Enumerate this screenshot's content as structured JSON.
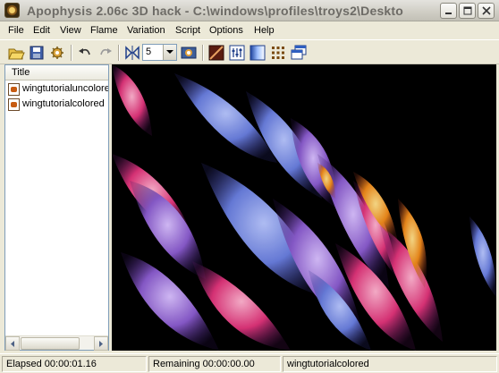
{
  "window": {
    "title": "Apophysis 2.06c 3D hack - C:\\windows\\profiles\\troys2\\Deskto",
    "buttons": [
      "minimize",
      "maximize",
      "close"
    ]
  },
  "menu": {
    "file": "File",
    "edit": "Edit",
    "view": "View",
    "flame": "Flame",
    "variation": "Variation",
    "script": "Script",
    "options": "Options",
    "help": "Help"
  },
  "toolbar": {
    "icons": [
      "open-icon",
      "save-icon",
      "settings-icon",
      "undo-icon",
      "redo-icon",
      "symmetry-icon",
      "render-icon",
      "gradient-icon",
      "adjust-icon",
      "palette-icon",
      "grid-icon",
      "window-icon"
    ],
    "combo_value": "5"
  },
  "list": {
    "header": "Title",
    "items": [
      {
        "label": "wingtutorialuncolored"
      },
      {
        "label": "wingtutorialcolored"
      }
    ]
  },
  "status": {
    "elapsed": "Elapsed 00:00:01.16",
    "remaining": "Remaining 00:00:00.00",
    "name": "wingtutorialcolored"
  },
  "colors": {
    "preview_bg": "#000000",
    "flame_blue": "#5a6fd6",
    "flame_pink": "#e0347a",
    "flame_orange": "#f08a1a",
    "flame_purple": "#8b5ccf"
  }
}
